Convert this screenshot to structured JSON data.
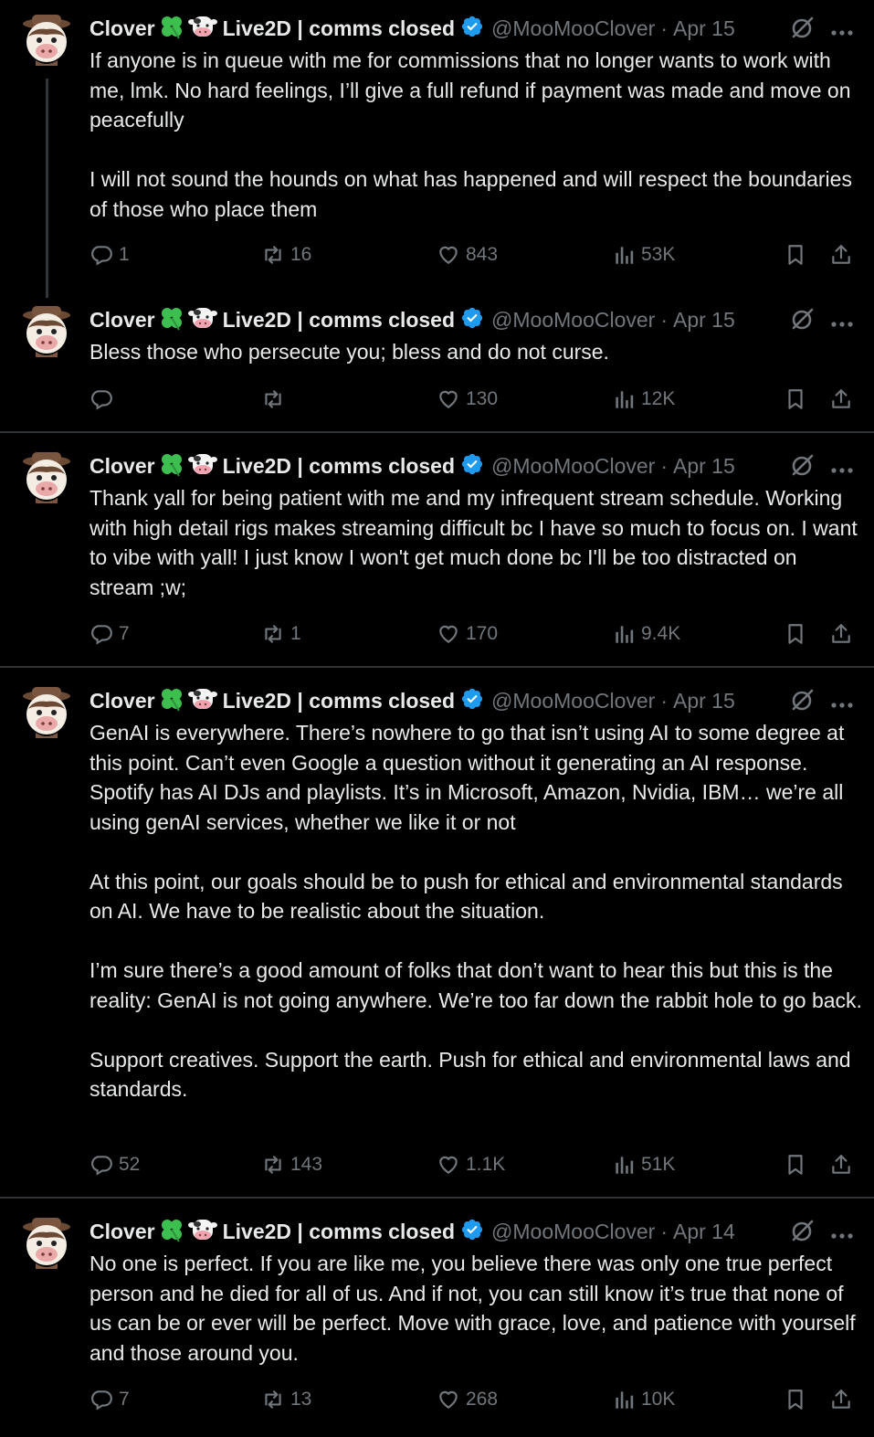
{
  "author": {
    "name": "Clover",
    "name_suffix": "Live2D | comms closed",
    "handle": "@MooMooClover"
  },
  "tweets": [
    {
      "date": "Apr 15",
      "text": "If anyone is in queue with me for commissions that no longer wants to work with me, lmk. No hard feelings, I’ll give a full refund if payment was made and move on peacefully\n\nI will not sound the hounds on what has happened and will respect the boundaries of those who place them",
      "replies": "1",
      "reposts": "16",
      "likes": "843",
      "views": "53K"
    },
    {
      "date": "Apr 15",
      "text": "Bless those who persecute you; bless and do not curse.",
      "replies": "",
      "reposts": "",
      "likes": "130",
      "views": "12K"
    },
    {
      "date": "Apr 15",
      "text": "Thank yall for being patient with me and my infrequent stream schedule. Working with high detail rigs makes streaming difficult bc I have so much to focus on. I want to vibe with yall! I just know I won't get much done bc I'll be too distracted on stream ;w;",
      "replies": "7",
      "reposts": "1",
      "likes": "170",
      "views": "9.4K"
    },
    {
      "date": "Apr 15",
      "text": "GenAI is everywhere. There’s nowhere to go that isn’t using AI to some degree at this point. Can’t even Google a question without it generating an AI response. Spotify has AI DJs and playlists. It’s in Microsoft, Amazon, Nvidia, IBM… we’re all using genAI services, whether we like it or not\n\nAt this point, our goals should be to push for ethical and environmental standards on AI. We have to be realistic about the situation.\n\nI’m sure there’s a good amount of folks that don’t want to hear this but this is the reality: GenAI is not going anywhere. We’re too far down the rabbit hole to go back.\n\nSupport creatives. Support the earth. Push for ethical and environmental laws and standards.",
      "replies": "52",
      "reposts": "143",
      "likes": "1.1K",
      "views": "51K"
    },
    {
      "date": "Apr 14",
      "text": "No one is perfect. If you are like me, you believe there was only one true perfect person and he died for all of us. And if not, you can still know it’s true that none of us can be or ever will be perfect. Move with grace, love, and patience with yourself and those around you.",
      "replies": "7",
      "reposts": "13",
      "likes": "268",
      "views": "10K"
    }
  ],
  "colors": {
    "background": "#000000",
    "text": "#e7e9ea",
    "muted": "#71767b",
    "verified": "#1d9bf0",
    "divider": "#2f3336",
    "clover": "#2fbf4a"
  }
}
